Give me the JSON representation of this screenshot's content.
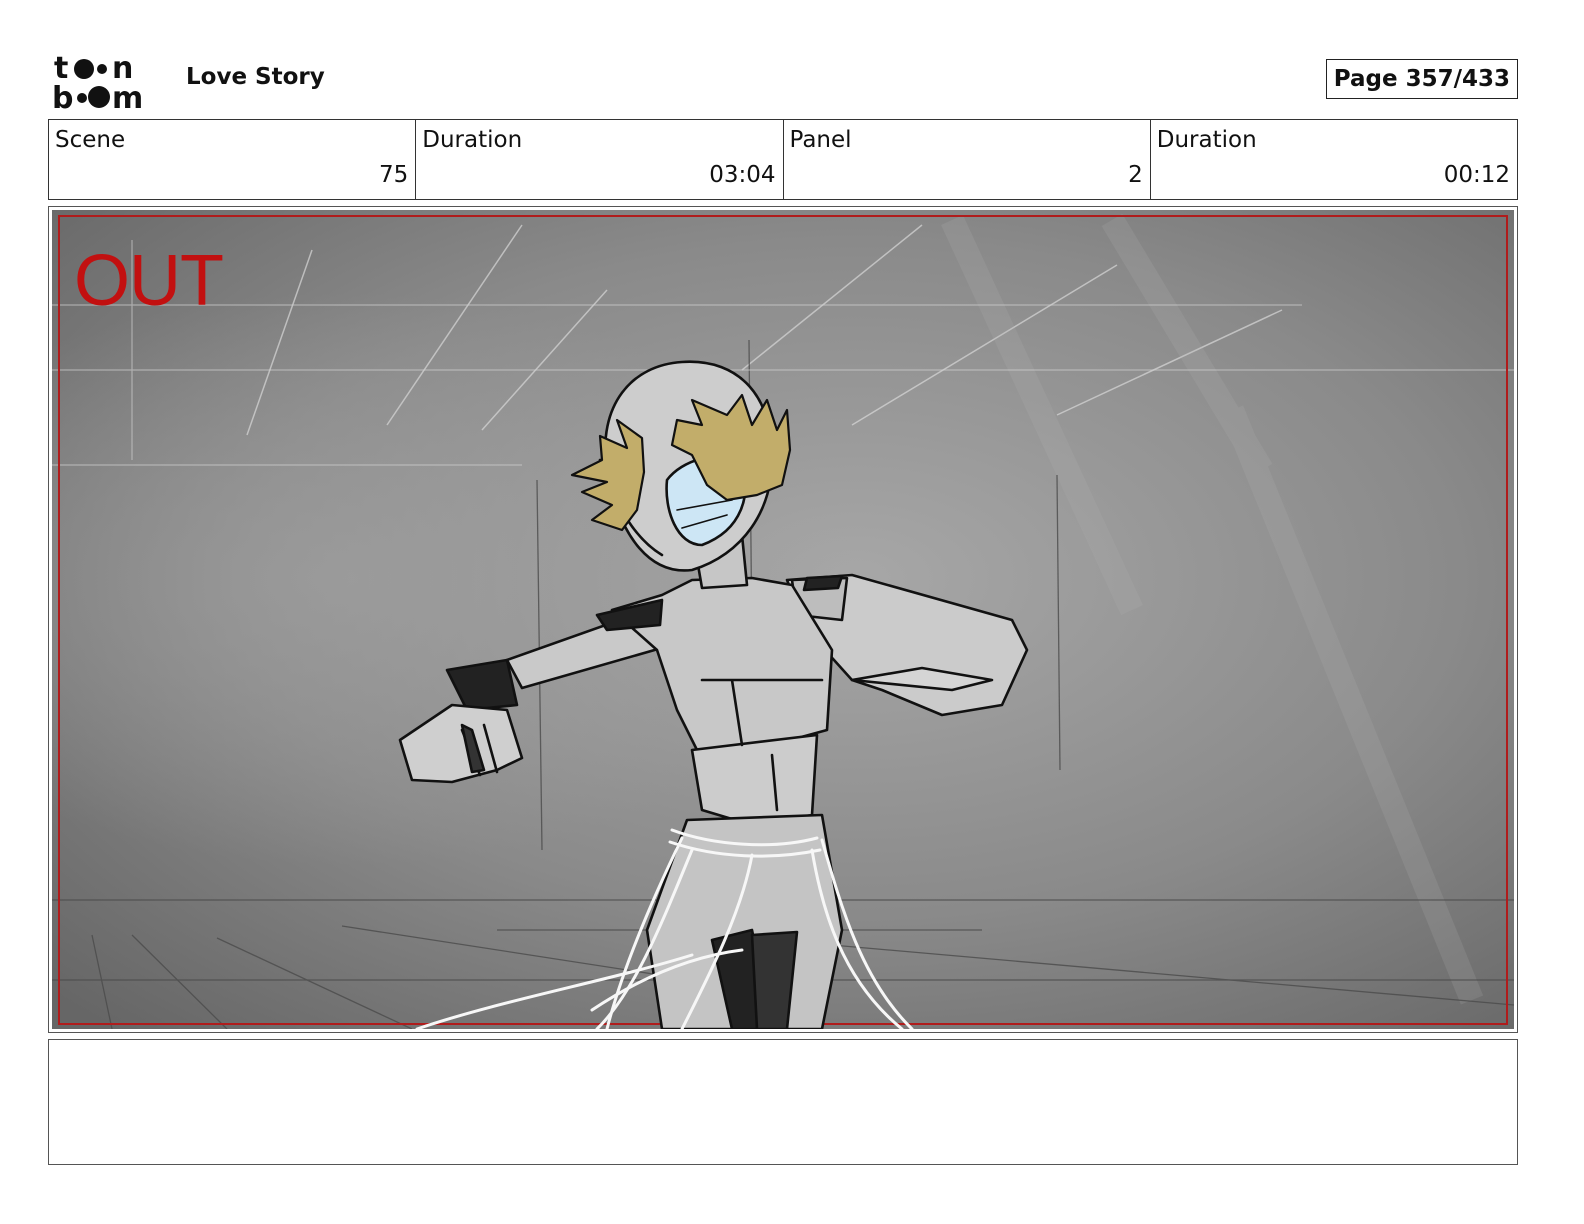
{
  "header": {
    "logo": {
      "name": "toonboom-logo",
      "line1": "to•n",
      "line2": "b••m"
    },
    "project_title": "Love Story",
    "page_label": "Page 357/433"
  },
  "info": {
    "scene": {
      "label": "Scene",
      "value": "75"
    },
    "scene_duration": {
      "label": "Duration",
      "value": "03:04"
    },
    "panel": {
      "label": "Panel",
      "value": "2"
    },
    "panel_duration": {
      "label": "Duration",
      "value": "00:12"
    }
  },
  "panel_image": {
    "overlay_label": "OUT",
    "frame_color": "#b01c1c",
    "hair_color": "#c2ad6a",
    "eye_color": "#cde6f5",
    "background_color": "#6f6f6f"
  },
  "notes": {
    "text": ""
  }
}
